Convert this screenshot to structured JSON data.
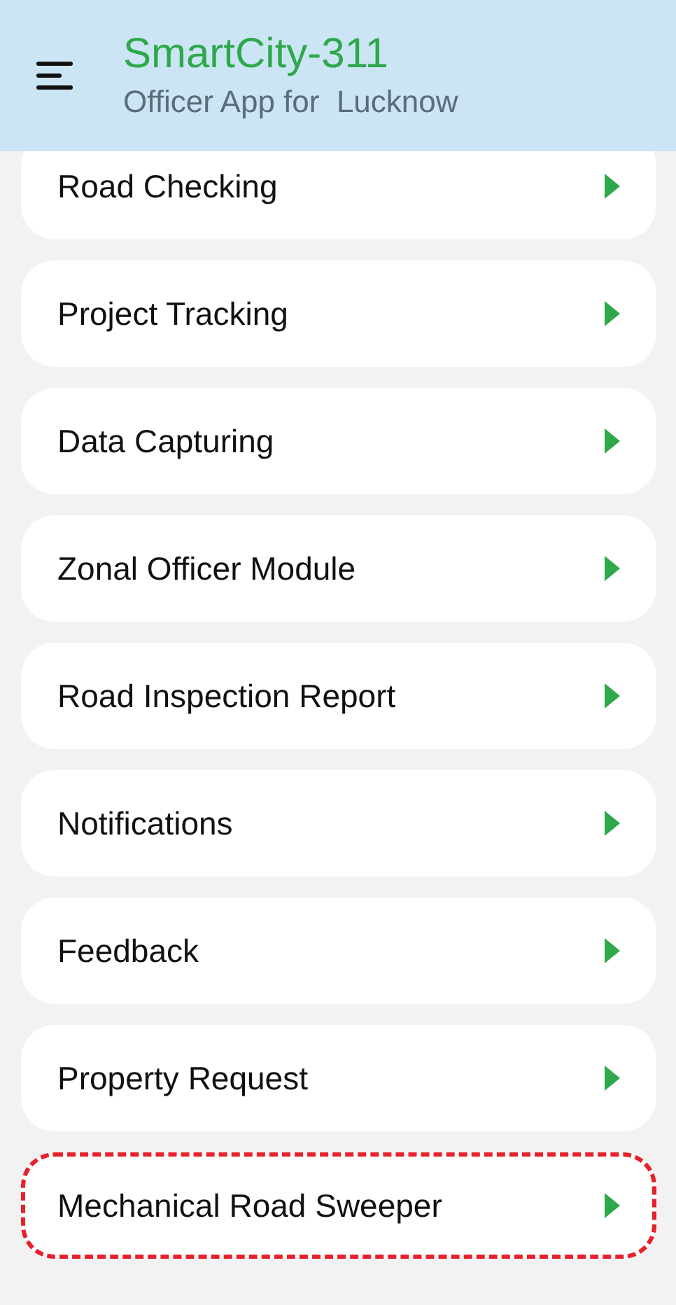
{
  "header": {
    "title": "SmartCity-311",
    "subtitle": "Officer App for  Lucknow"
  },
  "menu_items": [
    {
      "label": "Road Checking",
      "highlighted": false
    },
    {
      "label": "Project Tracking",
      "highlighted": false
    },
    {
      "label": "Data Capturing",
      "highlighted": false
    },
    {
      "label": "Zonal Officer Module",
      "highlighted": false
    },
    {
      "label": "Road Inspection Report",
      "highlighted": false
    },
    {
      "label": "Notifications",
      "highlighted": false
    },
    {
      "label": "Feedback",
      "highlighted": false
    },
    {
      "label": "Property Request",
      "highlighted": false
    },
    {
      "label": "Mechanical Road Sweeper",
      "highlighted": true
    }
  ]
}
